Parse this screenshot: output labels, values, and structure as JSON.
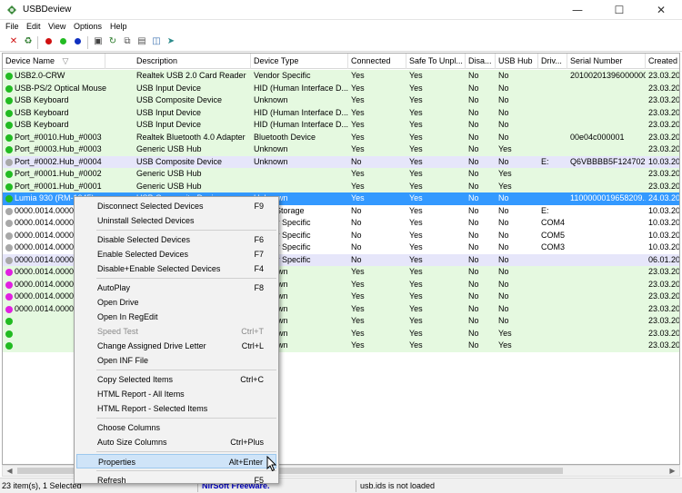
{
  "window": {
    "title": "USBDeview"
  },
  "menu": [
    "File",
    "Edit",
    "View",
    "Options",
    "Help"
  ],
  "columns": [
    "Device Name",
    "Description",
    "Device Type",
    "Connected",
    "Safe To Unpl...",
    "Disa...",
    "USB Hub",
    "Driv...",
    "Serial Number",
    "Created D"
  ],
  "rows": [
    {
      "led": "green",
      "bg": "#e5f9e0",
      "cells": [
        "USB2.0-CRW",
        "Realtek USB 2.0 Card Reader",
        "Vendor Specific",
        "Yes",
        "Yes",
        "No",
        "No",
        "",
        "20100201396000000",
        "23.03.2017"
      ]
    },
    {
      "led": "green",
      "bg": "#e5f9e0",
      "cells": [
        "USB-PS/2 Optical Mouse",
        "USB Input Device",
        "HID (Human Interface D...",
        "Yes",
        "Yes",
        "No",
        "No",
        "",
        "",
        "23.03.2017"
      ]
    },
    {
      "led": "green",
      "bg": "#e5f9e0",
      "cells": [
        "USB Keyboard",
        "USB Composite Device",
        "Unknown",
        "Yes",
        "Yes",
        "No",
        "No",
        "",
        "",
        "23.03.2017"
      ]
    },
    {
      "led": "green",
      "bg": "#e5f9e0",
      "cells": [
        "USB Keyboard",
        "USB Input Device",
        "HID (Human Interface D...",
        "Yes",
        "Yes",
        "No",
        "No",
        "",
        "",
        "23.03.2017"
      ]
    },
    {
      "led": "green",
      "bg": "#e5f9e0",
      "cells": [
        "USB Keyboard",
        "USB Input Device",
        "HID (Human Interface D...",
        "Yes",
        "Yes",
        "No",
        "No",
        "",
        "",
        "23.03.2017"
      ]
    },
    {
      "led": "green",
      "bg": "#e5f9e0",
      "cells": [
        "Port_#0010.Hub_#0003",
        "Realtek Bluetooth 4.0 Adapter",
        "Bluetooth Device",
        "Yes",
        "Yes",
        "No",
        "No",
        "",
        "00e04c000001",
        "23.03.2017"
      ]
    },
    {
      "led": "green",
      "bg": "#e5f9e0",
      "cells": [
        "Port_#0003.Hub_#0003",
        "Generic USB Hub",
        "Unknown",
        "Yes",
        "Yes",
        "No",
        "Yes",
        "",
        "",
        "23.03.2017"
      ]
    },
    {
      "led": "grey",
      "bg": "#e6e6fa",
      "cells": [
        "Port_#0002.Hub_#0004",
        "USB Composite Device",
        "Unknown",
        "No",
        "Yes",
        "No",
        "No",
        "E:",
        "Q6VBBBB5F1247021",
        "10.03.2017"
      ]
    },
    {
      "led": "green",
      "bg": "#e5f9e0",
      "cells": [
        "Port_#0001.Hub_#0002",
        "Generic USB Hub",
        "",
        "Yes",
        "Yes",
        "No",
        "Yes",
        "",
        "",
        "23.03.2017"
      ]
    },
    {
      "led": "green",
      "bg": "#e5f9e0",
      "cells": [
        "Port_#0001.Hub_#0001",
        "Generic USB Hub",
        "",
        "Yes",
        "Yes",
        "No",
        "Yes",
        "",
        "",
        "23.03.2017"
      ]
    },
    {
      "led": "green",
      "bg": "#3399ff",
      "sel": true,
      "cells": [
        "Lumia 930 (RM-1045)",
        "USB Composite Device",
        "Unknown",
        "Yes",
        "Yes",
        "No",
        "No",
        "",
        "1100000019658209...",
        "24.03.2017"
      ]
    },
    {
      "led": "grey",
      "bg": "#ffffff",
      "cells": [
        "0000.0014.0000.00",
        "",
        "Mass Storage",
        "No",
        "Yes",
        "No",
        "No",
        "E:",
        "",
        "10.03.2017"
      ]
    },
    {
      "led": "grey",
      "bg": "#ffffff",
      "cells": [
        "0000.0014.0000.00",
        "",
        "Vendor Specific",
        "No",
        "Yes",
        "No",
        "No",
        "COM4",
        "",
        "10.03.2017"
      ]
    },
    {
      "led": "grey",
      "bg": "#ffffff",
      "cells": [
        "0000.0014.0000.00",
        "",
        "Vendor Specific",
        "No",
        "Yes",
        "No",
        "No",
        "COM5",
        "",
        "10.03.2017"
      ]
    },
    {
      "led": "grey",
      "bg": "#ffffff",
      "cells": [
        "0000.0014.0000.00",
        "",
        "Vendor Specific",
        "No",
        "Yes",
        "No",
        "No",
        "COM3",
        "",
        "10.03.2017"
      ]
    },
    {
      "led": "grey",
      "bg": "#e6e6fa",
      "cells": [
        "0000.0014.0000.00",
        "",
        "Vendor Specific",
        "No",
        "Yes",
        "No",
        "No",
        "",
        "",
        "06.01.2017"
      ]
    },
    {
      "led": "magenta",
      "bg": "#e5f9e0",
      "cells": [
        "0000.0014.0000.00",
        "",
        "Unknown",
        "Yes",
        "Yes",
        "No",
        "No",
        "",
        "",
        "23.03.2017"
      ]
    },
    {
      "led": "magenta",
      "bg": "#e5f9e0",
      "cells": [
        "0000.0014.0000.00",
        "",
        "Unknown",
        "Yes",
        "Yes",
        "No",
        "No",
        "",
        "",
        "23.03.2017"
      ]
    },
    {
      "led": "magenta",
      "bg": "#e5f9e0",
      "cells": [
        "0000.0014.0000.00",
        "",
        "Unknown",
        "Yes",
        "Yes",
        "No",
        "No",
        "",
        "",
        "23.03.2017"
      ]
    },
    {
      "led": "magenta",
      "bg": "#e5f9e0",
      "cells": [
        "0000.0014.0000.00",
        "",
        "Unknown",
        "Yes",
        "Yes",
        "No",
        "No",
        "",
        "",
        "23.03.2017"
      ]
    },
    {
      "led": "green",
      "bg": "#e5f9e0",
      "cells": [
        "",
        "",
        "Unknown",
        "Yes",
        "Yes",
        "No",
        "No",
        "",
        "",
        "23.03.2017"
      ]
    },
    {
      "led": "green",
      "bg": "#e5f9e0",
      "cells": [
        "",
        "",
        "Unknown",
        "Yes",
        "Yes",
        "No",
        "Yes",
        "",
        "",
        "23.03.2017"
      ]
    },
    {
      "led": "green",
      "bg": "#e5f9e0",
      "cells": [
        "",
        "",
        "Unknown",
        "Yes",
        "Yes",
        "No",
        "Yes",
        "",
        "",
        "23.03.2017"
      ]
    }
  ],
  "context_menu": [
    {
      "label": "Disconnect Selected Devices",
      "shortcut": "F9"
    },
    {
      "label": "Uninstall Selected Devices",
      "shortcut": ""
    },
    {
      "sep": true
    },
    {
      "label": "Disable Selected Devices",
      "shortcut": "F6"
    },
    {
      "label": "Enable Selected Devices",
      "shortcut": "F7"
    },
    {
      "label": "Disable+Enable Selected Devices",
      "shortcut": "F4"
    },
    {
      "sep": true
    },
    {
      "label": "AutoPlay",
      "shortcut": "F8"
    },
    {
      "label": "Open Drive",
      "shortcut": ""
    },
    {
      "label": "Open In RegEdit",
      "shortcut": ""
    },
    {
      "label": "Speed Test",
      "shortcut": "Ctrl+T",
      "disabled": true
    },
    {
      "label": "Change Assigned Drive Letter",
      "shortcut": "Ctrl+L"
    },
    {
      "label": "Open INF File",
      "shortcut": ""
    },
    {
      "sep": true
    },
    {
      "label": "Copy Selected Items",
      "shortcut": "Ctrl+C"
    },
    {
      "label": "HTML Report - All Items",
      "shortcut": ""
    },
    {
      "label": "HTML Report - Selected Items",
      "shortcut": ""
    },
    {
      "sep": true
    },
    {
      "label": "Choose Columns",
      "shortcut": ""
    },
    {
      "label": "Auto Size Columns",
      "shortcut": "Ctrl+Plus"
    },
    {
      "sep": true
    },
    {
      "label": "Properties",
      "shortcut": "Alt+Enter",
      "highlighted": true
    },
    {
      "sep": true
    },
    {
      "label": "Refresh",
      "shortcut": "F5"
    }
  ],
  "status": {
    "count": "23 item(s), 1 Selected",
    "link": "NirSoft Freeware.  http://www.nirsoft.net",
    "usbids": "usb.ids is not loaded"
  },
  "colors": {
    "led_green": "#22bb22",
    "led_grey": "#a8a8a8",
    "led_magenta": "#e020e0",
    "selection": "#3399ff"
  }
}
